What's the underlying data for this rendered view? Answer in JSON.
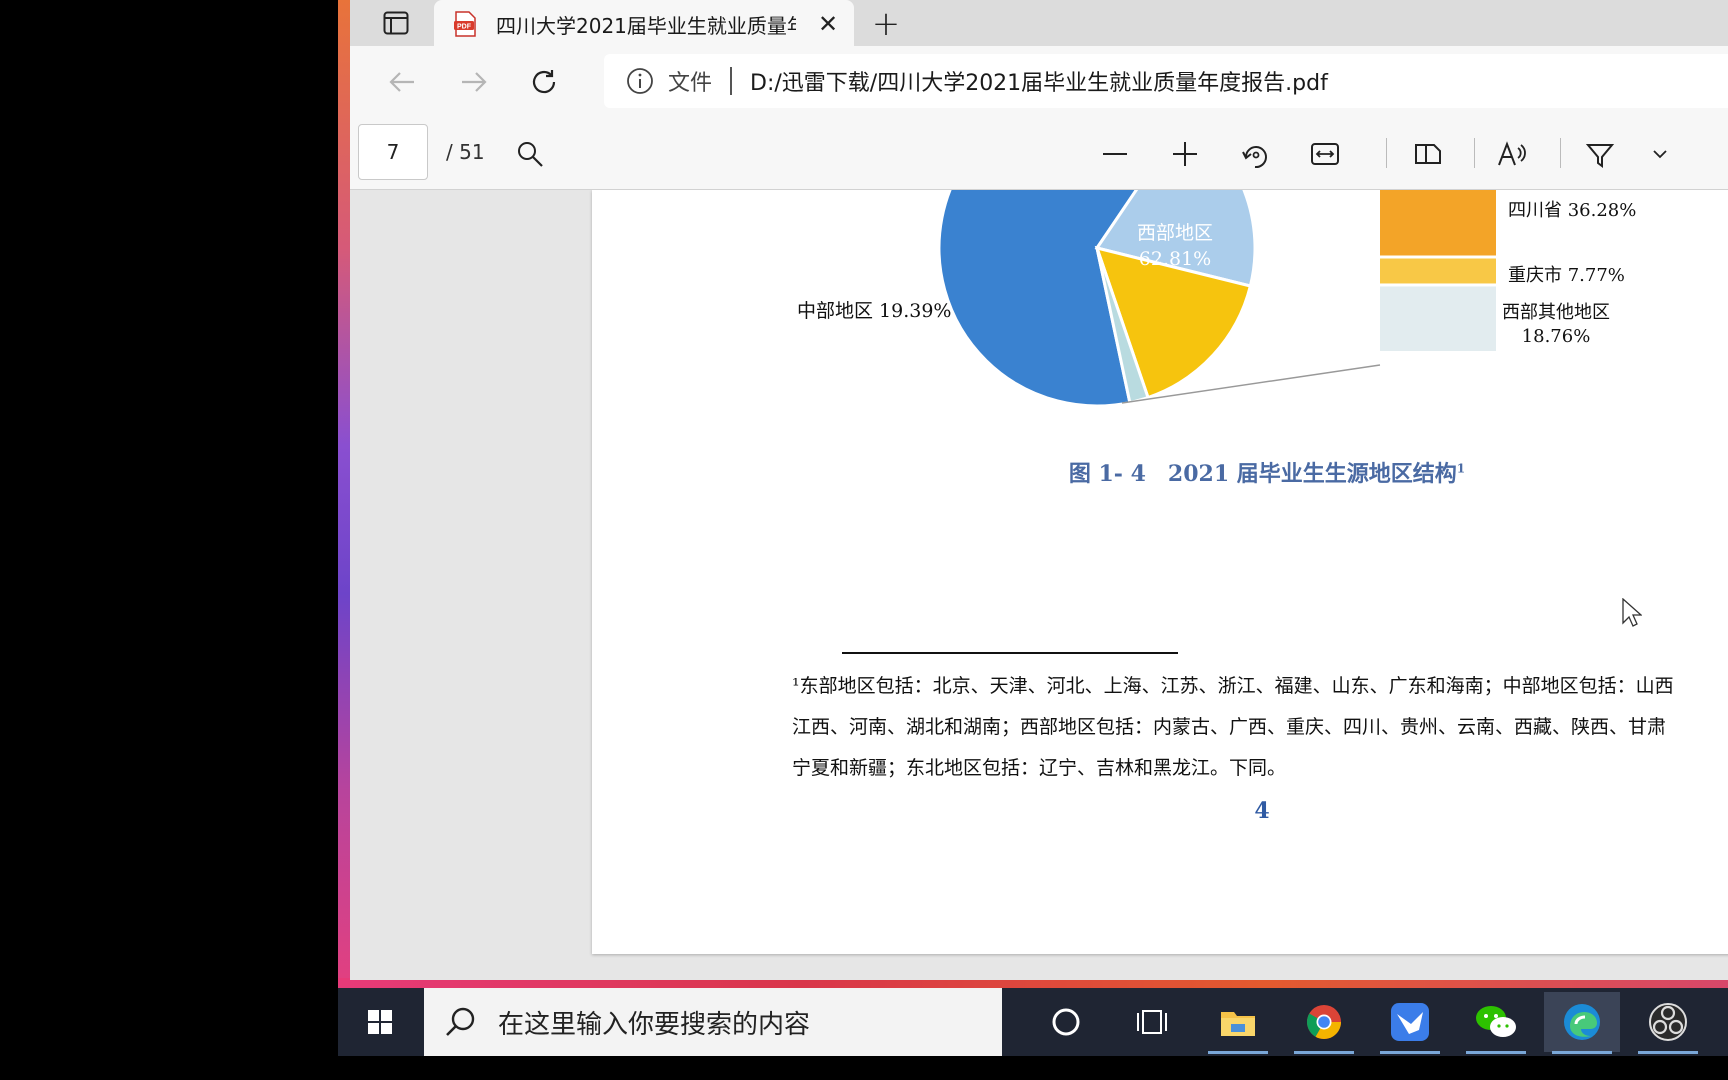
{
  "browser": {
    "tab": {
      "title": "四川大学2021届毕业生就业质量年度报告.pdf"
    },
    "address": {
      "file_label": "文件",
      "url": "D:/迅雷下载/四川大学2021届毕业生就业质量年度报告.pdf"
    }
  },
  "pdf_toolbar": {
    "page_input": "7",
    "page_total": "/ 51"
  },
  "document": {
    "pie_labels": {
      "west": {
        "name": "西部地区",
        "value": "62.81%"
      },
      "central": "中部地区 19.39%"
    },
    "bar_labels": {
      "sichuan": "四川省 36.28%",
      "chongqing": "重庆市 7.77%",
      "west_other_name": "西部其他地区",
      "west_other_value": "18.76%"
    },
    "figure_caption": {
      "text": "图 1- 4　2021 届毕业生生源地区结构",
      "sup": "1"
    },
    "footnote_lines": [
      "¹东部地区包括：北京、天津、河北、上海、江苏、浙江、福建、山东、广东和海南；中部地区包括：山西",
      "江西、河南、湖北和湖南；西部地区包括：内蒙古、广西、重庆、四川、贵州、云南、西藏、陕西、甘肃",
      "宁夏和新疆；东北地区包括：辽宁、吉林和黑龙江。下同。"
    ],
    "page_number": "4"
  },
  "chart_data": {
    "type": "pie",
    "title": "图 1- 4　2021 届毕业生生源地区结构",
    "slices": [
      {
        "label": "西部地区",
        "value": 62.81,
        "color": "#3a82d0"
      },
      {
        "label": "中部地区",
        "value": 19.39,
        "color": "#abcdeb"
      },
      {
        "label": "",
        "value": 15.9,
        "color": "#f6c40e"
      },
      {
        "label": "",
        "value": 1.9,
        "color": "#b9dbe0"
      }
    ],
    "breakdown": {
      "of": "西部地区",
      "segments": [
        {
          "label": "四川省",
          "value": 36.28,
          "color": "#f3a428"
        },
        {
          "label": "重庆市",
          "value": 7.77,
          "color": "#f8c846"
        },
        {
          "label": "西部其他地区",
          "value": 18.76,
          "color": "#e2ecef"
        }
      ]
    }
  },
  "taskbar": {
    "search_placeholder": "在这里输入你要搜索的内容",
    "icons": [
      "cortana-icon",
      "task-view-icon",
      "file-explorer-icon",
      "chrome-icon",
      "feishu-icon",
      "wechat-icon",
      "edge-icon",
      "obs-icon"
    ]
  }
}
